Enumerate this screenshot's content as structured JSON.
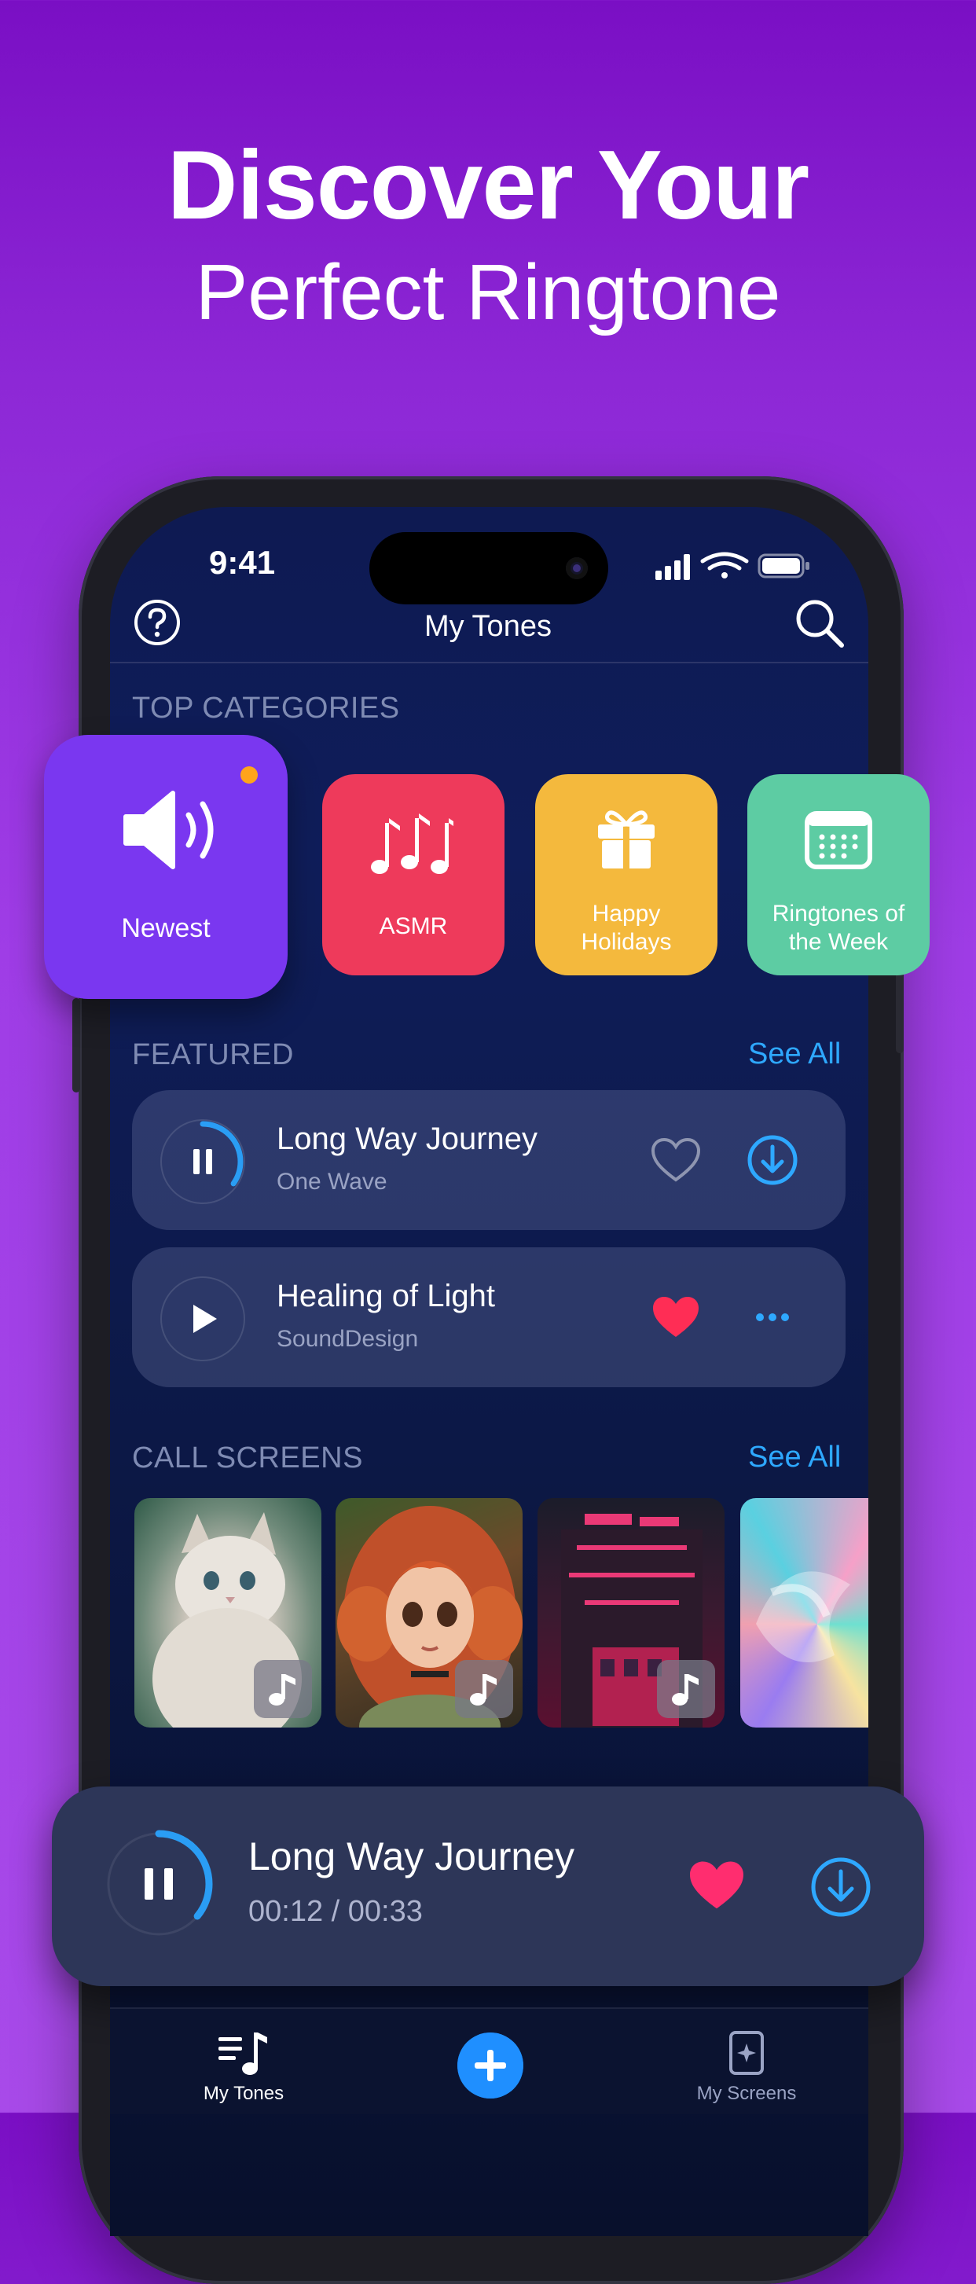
{
  "headline": {
    "line1": "Discover Your",
    "line2": "Perfect Ringtone"
  },
  "status_bar": {
    "time": "9:41"
  },
  "nav": {
    "title": "My Tones"
  },
  "sections": {
    "top_categories": "TOP CATEGORIES",
    "featured": "FEATURED",
    "call_screens": "CALL  SCREENS",
    "see_all": "See All"
  },
  "categories": [
    {
      "label": "Newest",
      "icon": "speaker-icon",
      "color": "#7a37f0",
      "has_new_dot": true
    },
    {
      "label": "ASMR",
      "icon": "music-notes-icon",
      "color": "#ee3a5b"
    },
    {
      "label": "Happy Holidays",
      "icon": "gift-icon",
      "color": "#f4b93d"
    },
    {
      "label": "Ringtones of the Week",
      "icon": "calendar-icon",
      "color": "#5dcca3"
    }
  ],
  "featured_tracks": [
    {
      "title": "Long Way Journey",
      "artist": "One Wave",
      "state": "playing",
      "progress": 0.35,
      "liked": false,
      "action": "download-icon"
    },
    {
      "title": "Healing of Light",
      "artist": "SoundDesign",
      "state": "paused",
      "liked": true,
      "action": "more-icon"
    }
  ],
  "call_screens": [
    {
      "name": "Kitten",
      "badge": "music-note-icon"
    },
    {
      "name": "Cartoon Girl",
      "badge": "music-note-icon"
    },
    {
      "name": "Neon City",
      "badge": "music-note-icon"
    },
    {
      "name": "Abstract Swirl",
      "badge": "music-note-icon"
    }
  ],
  "now_playing": {
    "title": "Long Way Journey",
    "time": "00:12 / 00:33",
    "progress": 0.36,
    "liked": true
  },
  "tab_bar": {
    "tabs": [
      {
        "label": "My Tones",
        "active": true
      },
      {
        "label": "My Screens",
        "active": false
      }
    ],
    "add_button": "plus-icon"
  },
  "colors": {
    "accent": "#2ea8ff",
    "heart": "#ff2d6f",
    "background_top": "#7a0fc4",
    "screen_bg": "#0e1a52"
  }
}
